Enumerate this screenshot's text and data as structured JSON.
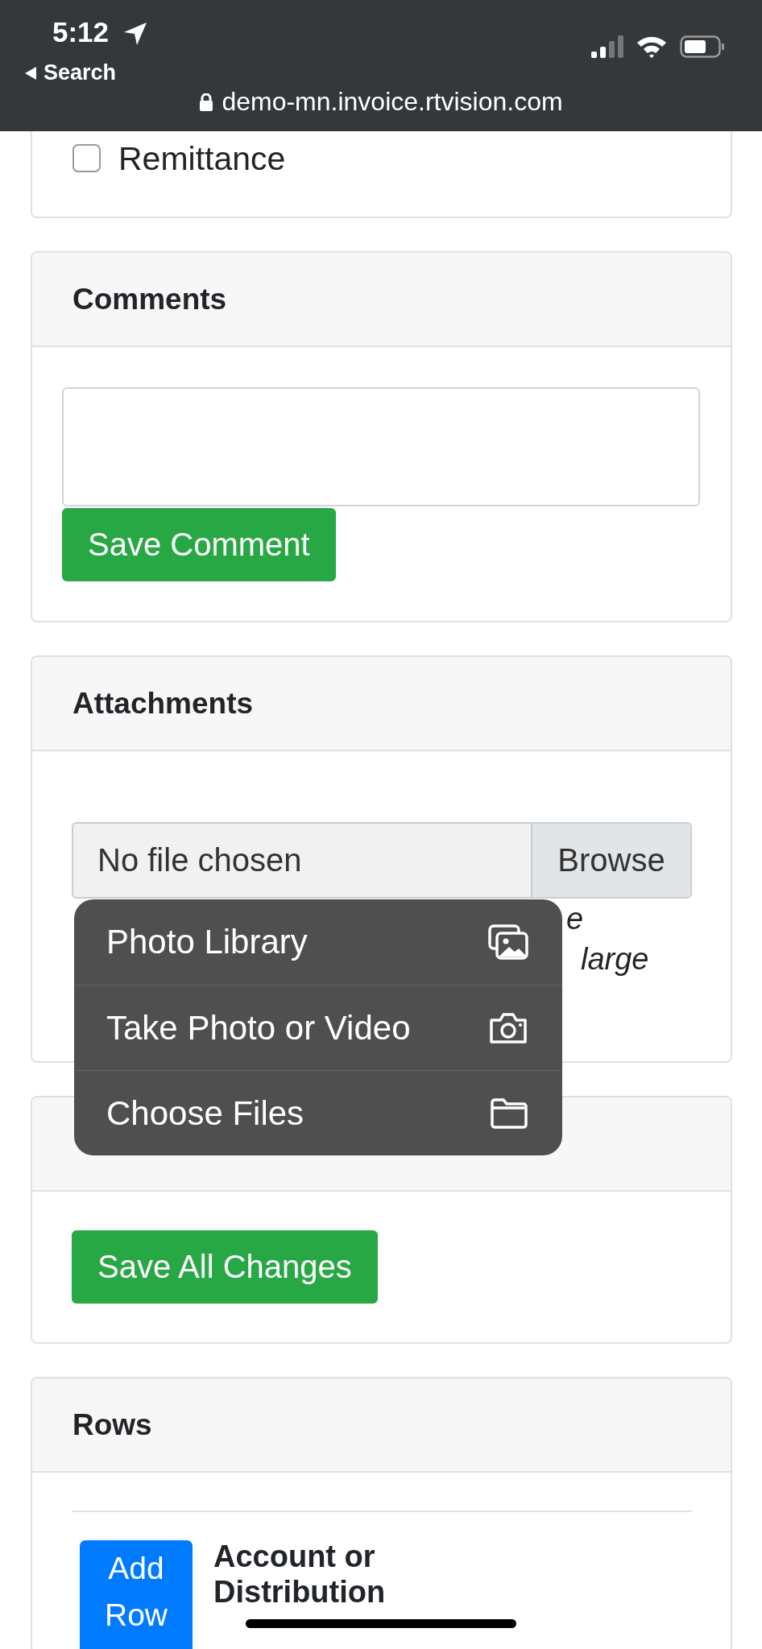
{
  "status_bar": {
    "time": "5:12",
    "back_label": "Search",
    "url": "demo-mn.invoice.rtvision.com"
  },
  "remittance": {
    "label": "Remittance",
    "checked": false
  },
  "comments": {
    "title": "Comments",
    "button": "Save Comment"
  },
  "attachments": {
    "title": "Attachments",
    "file_status": "No file chosen",
    "browse": "Browse",
    "help_fragments": [
      "e",
      "large"
    ]
  },
  "file_menu": {
    "items": [
      {
        "label": "Photo Library",
        "kind": "photos"
      },
      {
        "label": "Take Photo or Video",
        "kind": "camera"
      },
      {
        "label": "Choose Files",
        "kind": "folder"
      }
    ]
  },
  "actions": {
    "button": "Save All Changes"
  },
  "rows": {
    "title": "Rows",
    "button": "Add Row",
    "columns": [
      "Account or Distribution"
    ]
  }
}
